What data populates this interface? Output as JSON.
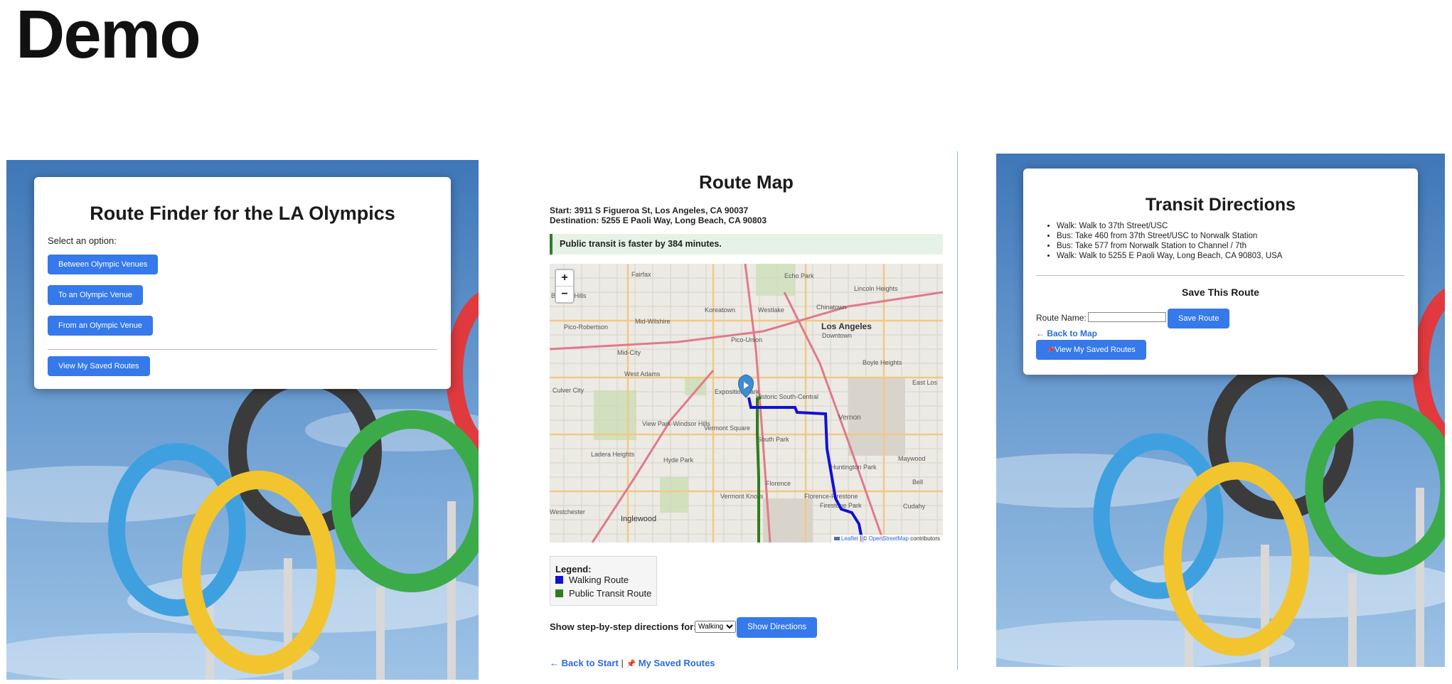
{
  "page": {
    "title": "Demo"
  },
  "finder": {
    "title": "Route Finder for the LA Olympics",
    "prompt": "Select an option:",
    "buttons": [
      "Between Olympic Venues",
      "To an Olympic Venue",
      "From an Olympic Venue"
    ],
    "saved_button": "View My Saved Routes"
  },
  "route_map": {
    "title": "Route Map",
    "start_label": "Start:",
    "start": "3911 S Figueroa St, Los Angeles, CA 90037",
    "destination_label": "Destination:",
    "destination": "5255 E Paoli Way, Long Beach, CA 90803",
    "faster_note": "Public transit is faster by 384 minutes.",
    "map": {
      "zoom_in": "+",
      "zoom_out": "−",
      "attribution_leaflet": "Leaflet",
      "attribution_sep": " | © ",
      "attribution_osm": "OpenStreetMap",
      "attribution_tail": " contributors",
      "place_labels": [
        "Fairfax",
        "Echo Park",
        "Beverly Hills",
        "Koreatown",
        "Westlake",
        "Chinatown",
        "Lincoln Heights",
        "Mid-Wilshire",
        "Los Angeles",
        "Downtown",
        "Pico-Robertson",
        "Pico-Union",
        "Mid-City",
        "West Adams",
        "Boyle Heights",
        "Culver City",
        "Exposition Park",
        "Historic South-Central",
        "East Los",
        "View Park-Windsor Hills",
        "Vermont Square",
        "Vernon",
        "South Park",
        "Ladera Heights",
        "Hyde Park",
        "Maywood",
        "Huntington Park",
        "Florence",
        "Bell",
        "Vermont Knolls",
        "Florence-Firestone",
        "Firestone Park",
        "Cudahy",
        "Westchester",
        "Inglewood"
      ]
    },
    "legend": {
      "title": "Legend:",
      "items": [
        {
          "label": "Walking Route",
          "color": "#1010d8"
        },
        {
          "label": "Public Transit Route",
          "color": "#2f7d1e"
        }
      ]
    },
    "directions_label": "Show step-by-step directions for:",
    "mode_options": [
      "Walking"
    ],
    "mode_selected": "Walking",
    "show_button": "Show Directions",
    "back_link": "← Back to Start",
    "separator": "|",
    "saved_link": "My Saved Routes"
  },
  "transit": {
    "title": "Transit Directions",
    "steps": [
      "Walk: Walk to 37th Street/USC",
      "Bus: Take 460 from 37th Street/USC to Norwalk Station",
      "Bus: Take 577 from Norwalk Station to Channel / 7th",
      "Walk: Walk to 5255 E Paoli Way, Long Beach, CA 90803, USA"
    ],
    "save_heading": "Save This Route",
    "route_name_label": "Route Name:",
    "route_name_value": "",
    "save_button": "Save Route",
    "back_link": "← Back to Map",
    "saved_button": "View My Saved Routes"
  },
  "colors": {
    "accent": "#3579ea",
    "walking": "#1010d8",
    "transit": "#2f7d1e",
    "notice_bg": "#e7f2e7",
    "notice_border": "#2f7d2f"
  }
}
